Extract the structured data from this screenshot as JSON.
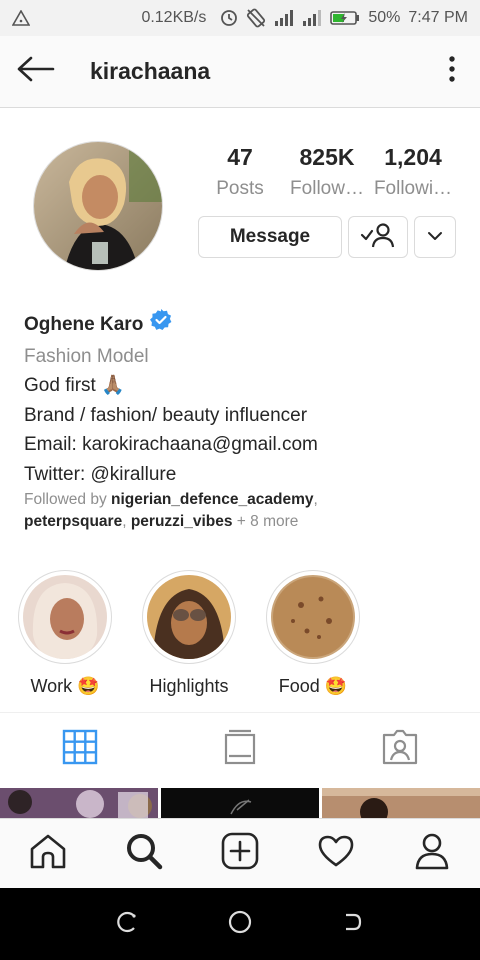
{
  "status_bar": {
    "speed": "0.12KB/s",
    "battery": "50%",
    "time": "7:47 PM"
  },
  "header": {
    "username": "kirachaana"
  },
  "profile": {
    "stats": [
      {
        "value": "47",
        "label": "Posts"
      },
      {
        "value": "825K",
        "label": "Follow…"
      },
      {
        "value": "1,204",
        "label": "Followi…"
      }
    ],
    "message_label": "Message",
    "name": "Oghene Karo",
    "category": "Fashion Model",
    "bio_lines": [
      "God first 🙏🏽",
      "Brand / fashion/ beauty influencer",
      "Email: karokirachaana@gmail.com",
      "Twitter: @kirallure"
    ],
    "followed_by_prefix": "Followed by ",
    "followed_by_users": [
      "nigerian_defence_academy",
      "peterpsquare",
      "peruzzi_vibes"
    ],
    "followed_by_more": "+ 8 more"
  },
  "highlights": [
    {
      "label": "Work 🤩"
    },
    {
      "label": "Highlights"
    },
    {
      "label": "Food 🤩"
    }
  ],
  "tabs": [
    {
      "icon": "grid-icon",
      "active": true
    },
    {
      "icon": "igtv-icon",
      "active": false
    },
    {
      "icon": "tagged-icon",
      "active": false
    }
  ],
  "bottom_nav": [
    "home-icon",
    "search-icon",
    "add-post-icon",
    "activity-heart-icon",
    "profile-icon"
  ],
  "colors": {
    "accent": "#3897f0",
    "muted": "#8e8e8e",
    "text": "#262626",
    "border": "#dbdbdb"
  }
}
